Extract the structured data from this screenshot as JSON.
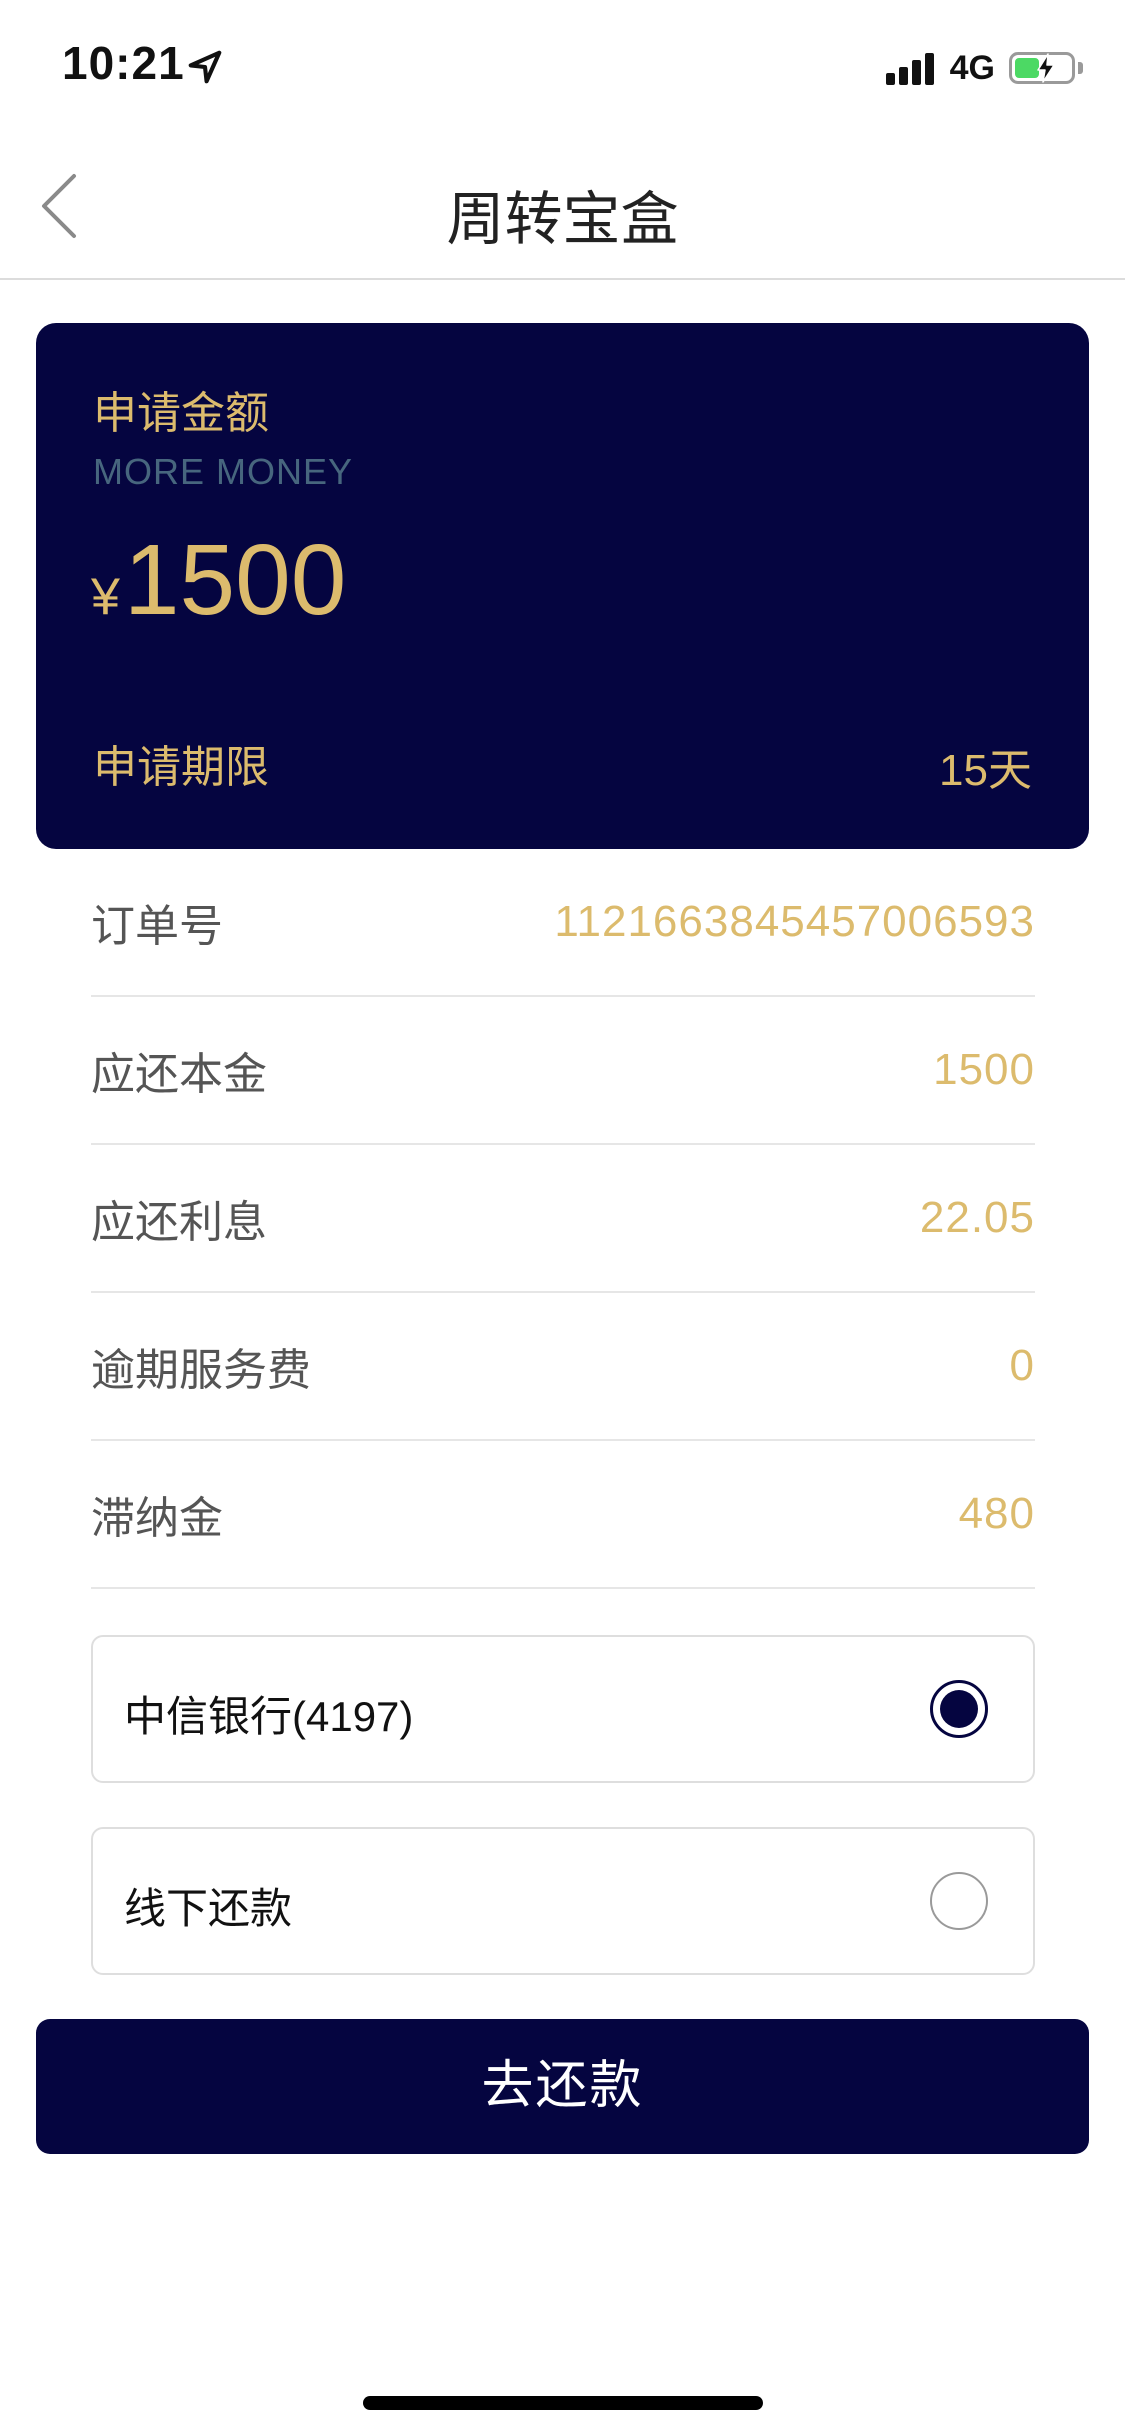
{
  "status_bar": {
    "time": "10:21",
    "network": "4G"
  },
  "nav": {
    "title": "周转宝盒"
  },
  "summary": {
    "title": "申请金额",
    "subtitle": "MORE MONEY",
    "currency": "¥",
    "amount": "1500",
    "term_label": "申请期限",
    "term_value": "15天"
  },
  "details": [
    {
      "label": "订单号",
      "value": "1121663845457006593"
    },
    {
      "label": "应还本金",
      "value": "1500"
    },
    {
      "label": "应还利息",
      "value": "22.05"
    },
    {
      "label": "逾期服务费",
      "value": "0"
    },
    {
      "label": "滞纳金",
      "value": "480"
    }
  ],
  "payment_options": [
    {
      "label": "中信银行(4197)",
      "selected": true
    },
    {
      "label": "线下还款",
      "selected": false
    }
  ],
  "repay_button": {
    "label": "去还款"
  },
  "colors": {
    "primary": "#050540",
    "gold": "#dcbb6d",
    "subtitle": "#47667e"
  }
}
